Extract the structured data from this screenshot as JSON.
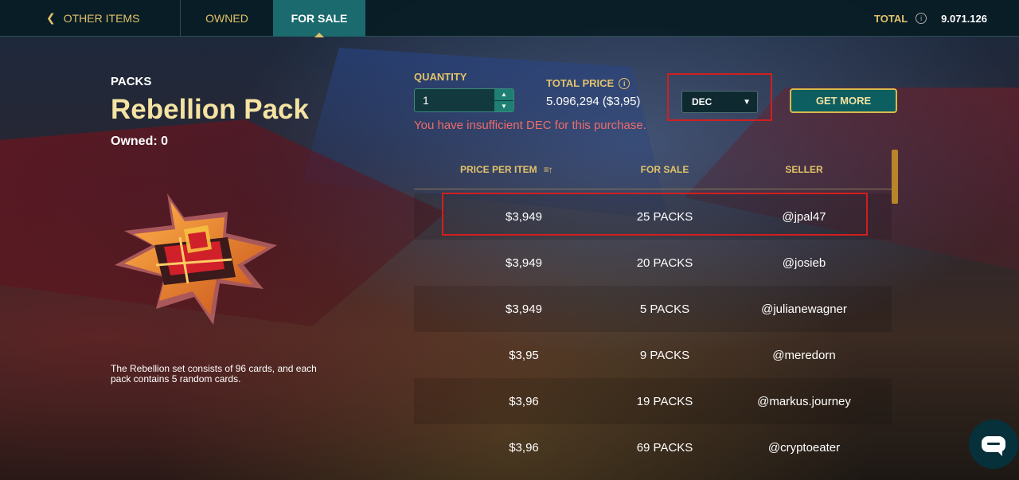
{
  "nav": {
    "back_label": "OTHER ITEMS",
    "tabs": [
      {
        "label": "OWNED",
        "active": false
      },
      {
        "label": "FOR SALE",
        "active": true
      }
    ],
    "total_label": "TOTAL",
    "total_value": "9.071.126"
  },
  "item": {
    "category": "PACKS",
    "name": "Rebellion Pack",
    "owned": "Owned: 0",
    "description": "The Rebellion set consists of 96 cards, and each pack contains 5 random cards."
  },
  "purchase": {
    "quantity_label": "QUANTITY",
    "quantity_value": "1",
    "total_price_label": "TOTAL PRICE",
    "total_price_value": "5.096,294 ($3,95)",
    "currency": "DEC",
    "warning": "You have insufficient DEC for this purchase.",
    "get_more_label": "GET MORE"
  },
  "table": {
    "columns": [
      "PRICE PER ITEM",
      "FOR SALE",
      "SELLER"
    ],
    "rows": [
      {
        "price": "$3,949",
        "for_sale": "25 PACKS",
        "seller": "@jpal47"
      },
      {
        "price": "$3,949",
        "for_sale": "20 PACKS",
        "seller": "@josieb"
      },
      {
        "price": "$3,949",
        "for_sale": "5 PACKS",
        "seller": "@julianewagner"
      },
      {
        "price": "$3,95",
        "for_sale": "9 PACKS",
        "seller": "@meredorn"
      },
      {
        "price": "$3,96",
        "for_sale": "19 PACKS",
        "seller": "@markus.journey"
      },
      {
        "price": "$3,96",
        "for_sale": "69 PACKS",
        "seller": "@cryptoeater"
      }
    ]
  },
  "colors": {
    "accent_gold": "#e2c26a",
    "active_tab": "#1a6a6e",
    "warning": "#ef6b6b",
    "highlight_box": "#d21e1e"
  },
  "icons": [
    "chevron-left-icon",
    "info-icon",
    "sort-icon",
    "chevron-down-icon",
    "chat-icon"
  ]
}
